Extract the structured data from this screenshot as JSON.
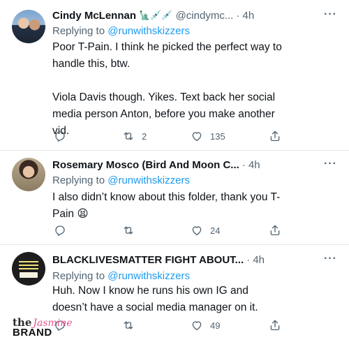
{
  "tweets": [
    {
      "name": "Cindy McLennan",
      "emojis": "🗽💉💉",
      "handle": "@cindymc...",
      "time": "· 4h",
      "more": "···",
      "replying_prefix": "Replying to ",
      "replying_to": "@runwithskizzers",
      "text_1": "Poor T-Pain. I think he picked the perfect way to handle this, btw.",
      "text_2": "Viola Davis though. Yikes. Text back her social media person Anton, before you make another vid.",
      "retweets": "2",
      "likes": "135"
    },
    {
      "name": "Rosemary Mosco (Bird And Moon C...",
      "time": "· 4h",
      "more": "···",
      "replying_prefix": "Replying to ",
      "replying_to": "@runwithskizzers",
      "text_1": "I also didn’t know about this folder, thank you T-Pain 😫",
      "likes": "24"
    },
    {
      "name": "BLACKLIVESMATTER FIGHT ABOUT...",
      "time": "· 4h",
      "more": "···",
      "replying_prefix": "Replying to ",
      "replying_to": "@runwithskizzers",
      "text_1": "Huh. Now I know he runs his own IG and doesn’t have a social media manager on it.",
      "likes": "49"
    }
  ],
  "watermark": {
    "the": "the",
    "jasmine": "Jasmine",
    "brand": "BRAND"
  }
}
